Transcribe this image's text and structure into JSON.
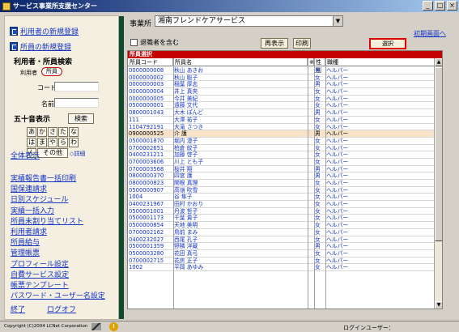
{
  "window": {
    "title": "サービス事業所支援センター",
    "buttons": [
      "_",
      "□",
      "×"
    ]
  },
  "sidebar": {
    "new_user": "利用者の新規登録",
    "new_staff": "所員の新規登録",
    "search_heading": "利用者・所員検索",
    "type_user": "利用者",
    "type_staff": "所員",
    "code_label": "コード",
    "code_value": "",
    "name_label": "名前",
    "name_value": "",
    "kana_heading": "五十音表示",
    "search_button": "検索",
    "kana_rows": [
      [
        "あ",
        "か",
        "さ",
        "た",
        "な"
      ],
      [
        "は",
        "ま",
        "や",
        "ら",
        "わ"
      ]
    ],
    "kana_n": "ん",
    "kana_other": "その他",
    "detail": "詳細",
    "show_all": "全体表示",
    "menu": [
      "実績報告書一括印刷",
      "国保連請求",
      "日別スケジュール",
      "実績一括入力",
      "所員未割り当てリスト",
      "利用者請求",
      "所員給与",
      "管理帳票",
      "プロフィール設定",
      "自費サービス設定",
      "帳票テンプレート",
      "パスワード・ユーザー名設定"
    ],
    "exit": "終了",
    "logoff": "ログオフ"
  },
  "toolbar": {
    "office_label": "事業所",
    "office_value": "湘南フレンドケアサービス",
    "initial_screen": "初期画面へ",
    "include_retired": "退職者を含む",
    "redisplay": "再表示",
    "print": "印刷",
    "select": "選択"
  },
  "grid": {
    "title": "所員選択",
    "columns": [
      "所員コード",
      "所員名",
      "※",
      "性別",
      "職種"
    ],
    "rows": [
      [
        "0000000008",
        "秋山 あきお",
        "男",
        "ヘルパー"
      ],
      [
        "0000000002",
        "秋山 聡子",
        "女",
        "ヘルパー"
      ],
      [
        "0000000003",
        "稲葉 厚志",
        "男",
        "ヘルパー"
      ],
      [
        "0000000004",
        "井上 真央",
        "女",
        "ヘルパー"
      ],
      [
        "0000000005",
        "今井 美紀",
        "女",
        "ヘルパー"
      ],
      [
        "0500000001",
        "遠藤 文代",
        "女",
        "ヘルパー"
      ],
      [
        "0800001043",
        "大木 ぽんど",
        "男",
        "ヘルパー"
      ],
      [
        "111",
        "大澤 祐子",
        "女",
        "ヘルパー"
      ],
      [
        "1104792191",
        "大滝 さつき",
        "女",
        "ヘルパー"
      ],
      [
        "0900000525",
        "介 護",
        "男",
        "ヘルパー"
      ],
      [
        "0500001870",
        "堀内 澄子",
        "女",
        "ヘルパー"
      ],
      [
        "0700002651",
        "柏倉 紋子",
        "女",
        "ヘルパー"
      ],
      [
        "0400231211",
        "加藤 啓子",
        "女",
        "ヘルパー"
      ],
      [
        "0700003606",
        "川上 とも子",
        "女",
        "ヘルパー"
      ],
      [
        "0700003568",
        "桜井 翔",
        "男",
        "ヘルパー"
      ],
      [
        "0800000370",
        "四宮 護",
        "男",
        "ヘルパー"
      ],
      [
        "0800000823",
        "関根 真理",
        "女",
        "ヘルパー"
      ],
      [
        "0500000907",
        "高嶺 吹雪",
        "女",
        "ヘルパー"
      ],
      [
        "1004",
        "谷 隼子",
        "女",
        "ヘルパー"
      ],
      [
        "0400231967",
        "田村 かおり",
        "女",
        "ヘルパー"
      ],
      [
        "0500001001",
        "丹波 哲子",
        "女",
        "ヘルパー"
      ],
      [
        "0500001173",
        "千葉 貴子",
        "女",
        "ヘルパー"
      ],
      [
        "0500000854",
        "天地 美明",
        "女",
        "ヘルパー"
      ],
      [
        "0700002162",
        "鳥前 まみ",
        "女",
        "ヘルパー"
      ],
      [
        "0400232027",
        "西尾 孔子",
        "女",
        "ヘルパー"
      ],
      [
        "0500001359",
        "野隣 洋蔵",
        "男",
        "ヘルパー"
      ],
      [
        "0500003280",
        "花田 真弓",
        "女",
        "ヘルパー"
      ],
      [
        "0700002715",
        "花房 正子",
        "女",
        "ヘルパー"
      ],
      [
        "1002",
        "平岡 あゆみ",
        "女",
        "ヘルパー"
      ]
    ],
    "selected_index": 9
  },
  "status": {
    "copyright": "Copyright (C)2004 LCNet Corporation",
    "login_user": "ログインユーザー："
  }
}
